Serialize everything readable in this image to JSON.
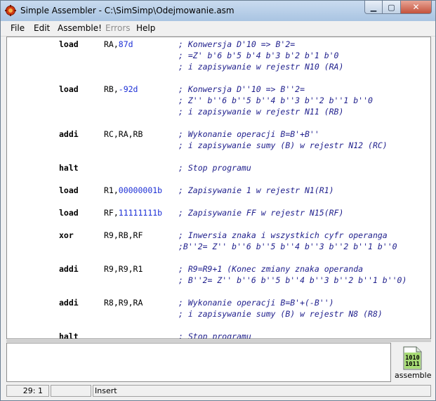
{
  "window": {
    "title": "Simple Assembler - C:\\SimSimp\\Odejmowanie.asm",
    "app_icon": "gear-bug-icon",
    "caption": {
      "minimize": "▁",
      "maximize": "▢",
      "close": "✕"
    }
  },
  "menu": {
    "file": "File",
    "edit": "Edit",
    "assemble": "Assemble!",
    "errors": "Errors",
    "help": "Help"
  },
  "code_lines": [
    {
      "mn": "load",
      "op": "RA,",
      "num": "87d",
      "cm": "; Konwersja D'10 => B'2="
    },
    {
      "mn": "",
      "op": "",
      "num": "",
      "cm": "; =Z' b'6 b'5 b'4 b'3 b'2 b'1 b'0"
    },
    {
      "mn": "",
      "op": "",
      "num": "",
      "cm": "; i zapisywanie w rejestr N10 (RA)"
    },
    {
      "mn": "",
      "op": "",
      "num": "",
      "cm": ""
    },
    {
      "mn": "load",
      "op": "RB,",
      "num": "-92d",
      "cm": "; Konwersja D''10 => B''2="
    },
    {
      "mn": "",
      "op": "",
      "num": "",
      "cm": "; Z'' b''6 b''5 b''4 b''3 b''2 b''1 b''0"
    },
    {
      "mn": "",
      "op": "",
      "num": "",
      "cm": "; i zapisywanie w rejestr N11 (RB)"
    },
    {
      "mn": "",
      "op": "",
      "num": "",
      "cm": ""
    },
    {
      "mn": "addi",
      "op": "RC,RA,RB",
      "num": "",
      "cm": "; Wykonanie operacji B=B'+B''"
    },
    {
      "mn": "",
      "op": "",
      "num": "",
      "cm": "; i zapisywanie sumy (B) w rejestr N12 (RC)"
    },
    {
      "mn": "",
      "op": "",
      "num": "",
      "cm": ""
    },
    {
      "mn": "halt",
      "op": "",
      "num": "",
      "cm": "; Stop programu"
    },
    {
      "mn": "",
      "op": "",
      "num": "",
      "cm": ""
    },
    {
      "mn": "load",
      "op": "R1,",
      "num": "00000001b",
      "cm": "; Zapisywanie 1 w rejestr N1(R1)"
    },
    {
      "mn": "",
      "op": "",
      "num": "",
      "cm": ""
    },
    {
      "mn": "load",
      "op": "RF,",
      "num": "11111111b",
      "cm": "; Zapisywanie FF w rejestr N15(RF)"
    },
    {
      "mn": "",
      "op": "",
      "num": "",
      "cm": ""
    },
    {
      "mn": "xor",
      "op": "R9,RB,RF",
      "num": "",
      "cm": "; Inwersia znaka i wszystkich cyfr operanga"
    },
    {
      "mn": "",
      "op": "",
      "num": "",
      "cm": ";B''2= Z'' b''6 b''5 b''4 b''3 b''2 b''1 b''0"
    },
    {
      "mn": "",
      "op": "",
      "num": "",
      "cm": ""
    },
    {
      "mn": "addi",
      "op": "R9,R9,R1",
      "num": "",
      "cm": "; R9=R9+1 (Konec zmiany znaka operanda"
    },
    {
      "mn": "",
      "op": "",
      "num": "",
      "cm": "; B''2= Z'' b''6 b''5 b''4 b''3 b''2 b''1 b''0)"
    },
    {
      "mn": "",
      "op": "",
      "num": "",
      "cm": ""
    },
    {
      "mn": "addi",
      "op": "R8,R9,RA",
      "num": "",
      "cm": "; Wykonanie operacji B=B'+(-B'')"
    },
    {
      "mn": "",
      "op": "",
      "num": "",
      "cm": "; i zapisywanie sumy (B) w rejestr N8 (R8)"
    },
    {
      "mn": "",
      "op": "",
      "num": "",
      "cm": ""
    },
    {
      "mn": "halt",
      "op": "",
      "num": "",
      "cm": "; Stop programu"
    }
  ],
  "assemble_button": {
    "label": "assemble",
    "icon": "binary-file-icon",
    "icon_text": [
      "1010",
      "1011"
    ]
  },
  "status": {
    "position": "29: 1",
    "blank": "",
    "mode": "Insert"
  },
  "colors": {
    "number": "#1c2fd6",
    "comment": "#1f1f8c",
    "title_bar": "#b8cfe9",
    "close_button": "#c4523b"
  }
}
